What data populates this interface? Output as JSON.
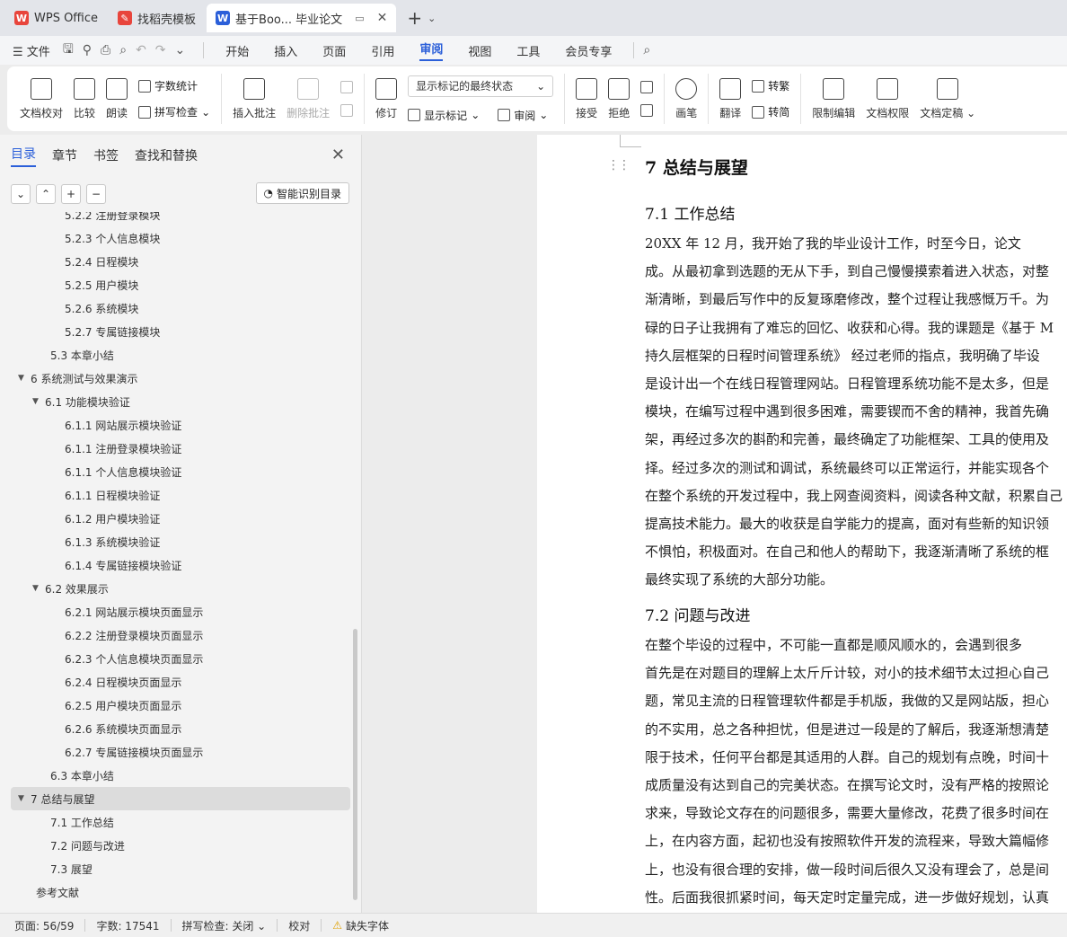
{
  "tabs": {
    "app": "WPS Office",
    "template": "找稻壳模板",
    "doc": "基于Boo... 毕业论文",
    "new_tab": "+"
  },
  "menu": {
    "file": "文件",
    "ribbon_tabs": [
      "开始",
      "插入",
      "页面",
      "引用",
      "审阅",
      "视图",
      "工具",
      "会员专享"
    ],
    "active_tab": "审阅"
  },
  "ribbon": {
    "proofread": "文档校对",
    "compare": "比较",
    "read_aloud": "朗读",
    "word_count": "字数统计",
    "spell_check": "拼写检查",
    "insert_comment": "插入批注",
    "delete_comment": "删除批注",
    "revise": "修订",
    "markup_select": "显示标记的最终状态",
    "show_markup": "显示标记",
    "review_pane": "审阅",
    "accept": "接受",
    "reject": "拒绝",
    "pen": "画笔",
    "translate": "翻译",
    "to_traditional": "转繁",
    "to_simplified": "转简",
    "restrict_edit": "限制编辑",
    "doc_permission": "文档权限",
    "doc_finalize": "文档定稿"
  },
  "nav": {
    "tabs": [
      "目录",
      "章节",
      "书签",
      "查找和替换"
    ],
    "active": "目录",
    "smart_toc": "智能识别目录",
    "toc": [
      {
        "text": "5.2.2  注册登录模块",
        "level": 3
      },
      {
        "text": "5.2.3  个人信息模块",
        "level": 3
      },
      {
        "text": "5.2.4  日程模块",
        "level": 3
      },
      {
        "text": "5.2.5  用户模块",
        "level": 3
      },
      {
        "text": "5.2.6  系统模块",
        "level": 3
      },
      {
        "text": "5.2.7  专属链接模块",
        "level": 3
      },
      {
        "text": "5.3  本章小结",
        "level": 2
      },
      {
        "text": "6  系统测试与效果演示",
        "level": 1,
        "expanded": true
      },
      {
        "text": "6.1  功能模块验证",
        "level": 2,
        "expanded": true
      },
      {
        "text": "6.1.1  网站展示模块验证",
        "level": 3
      },
      {
        "text": "6.1.1  注册登录模块验证",
        "level": 3
      },
      {
        "text": "6.1.1  个人信息模块验证",
        "level": 3
      },
      {
        "text": "6.1.1  日程模块验证",
        "level": 3
      },
      {
        "text": "6.1.2  用户模块验证",
        "level": 3
      },
      {
        "text": "6.1.3  系统模块验证",
        "level": 3
      },
      {
        "text": "6.1.4  专属链接模块验证",
        "level": 3
      },
      {
        "text": "6.2  效果展示",
        "level": 2,
        "expanded": true
      },
      {
        "text": "6.2.1  网站展示模块页面显示",
        "level": 3
      },
      {
        "text": "6.2.2  注册登录模块页面显示",
        "level": 3
      },
      {
        "text": "6.2.3  个人信息模块页面显示",
        "level": 3
      },
      {
        "text": "6.2.4  日程模块页面显示",
        "level": 3
      },
      {
        "text": "6.2.5  用户模块页面显示",
        "level": 3
      },
      {
        "text": "6.2.6  系统模块页面显示",
        "level": 3
      },
      {
        "text": "6.2.7  专属链接模块页面显示",
        "level": 3
      },
      {
        "text": "6.3  本章小结",
        "level": 2
      },
      {
        "text": "7  总结与展望",
        "level": 1,
        "expanded": true,
        "selected": true
      },
      {
        "text": "7.1  工作总结",
        "level": 2
      },
      {
        "text": "7.2  问题与改进",
        "level": 2
      },
      {
        "text": "7.3  展望",
        "level": 2
      },
      {
        "text": "参考文献",
        "level": 1
      }
    ]
  },
  "document": {
    "h1": "7  总结与展望",
    "h2_1": "7.1  工作总结",
    "para1": [
      "  20XX 年 12 月，我开始了我的毕业设计工作，时至今日，论文",
      "成。从最初拿到选题的无从下手，到自己慢慢摸索着进入状态，对整",
      "渐清晰，到最后写作中的反复琢磨修改，整个过程让我感慨万千。为",
      "碌的日子让我拥有了难忘的回忆、收获和心得。我的课题是《基于 M",
      "持久层框架的日程时间管理系统》 经过老师的指点，我明确了毕设",
      "是设计出一个在线日程管理网站。日程管理系统功能不是太多，但是",
      "模块，在编写过程中遇到很多困难，需要锲而不舍的精神，我首先确",
      "架，再经过多次的斟酌和完善，最终确定了功能框架、工具的使用及",
      "择。经过多次的测试和调试，系统最终可以正常运行，并能实现各个",
      "在整个系统的开发过程中，我上网查阅资料，阅读各种文献，积累自己",
      "提高技术能力。最大的收获是自学能力的提高，面对有些新的知识领",
      "不惧怕，积极面对。在自己和他人的帮助下，我逐渐清晰了系统的框",
      "最终实现了系统的大部分功能。"
    ],
    "h2_2": "7.2  问题与改进",
    "para2": [
      "  在整个毕设的过程中，不可能一直都是顺风顺水的，会遇到很多",
      "首先是在对题目的理解上太斤斤计较，对小的技术细节太过担心自己",
      "题，常见主流的日程管理软件都是手机版，我做的又是网站版，担心",
      "的不实用，总之各种担忧，但是进过一段是的了解后，我逐渐想清楚",
      "限于技术，任何平台都是其适用的人群。自己的规划有点晚，时间十",
      "成质量没有达到自己的完美状态。在撰写论文时，没有严格的按照论",
      "求来，导致论文存在的问题很多，需要大量修改，花费了很多时间在",
      "上，在内容方面，起初也没有按照软件开发的流程来，导致大篇幅修",
      "上，也没有很合理的安排，做一段时间后很久又没有理会了，总是间",
      "性。后面我很抓紧时间，每天定时定量完成，进一步做好规划，认真"
    ]
  },
  "status": {
    "page": "页面: 56/59",
    "words": "字数: 17541",
    "spell": "拼写检查: 关闭",
    "proof": "校对",
    "missing_font": "缺失字体"
  }
}
